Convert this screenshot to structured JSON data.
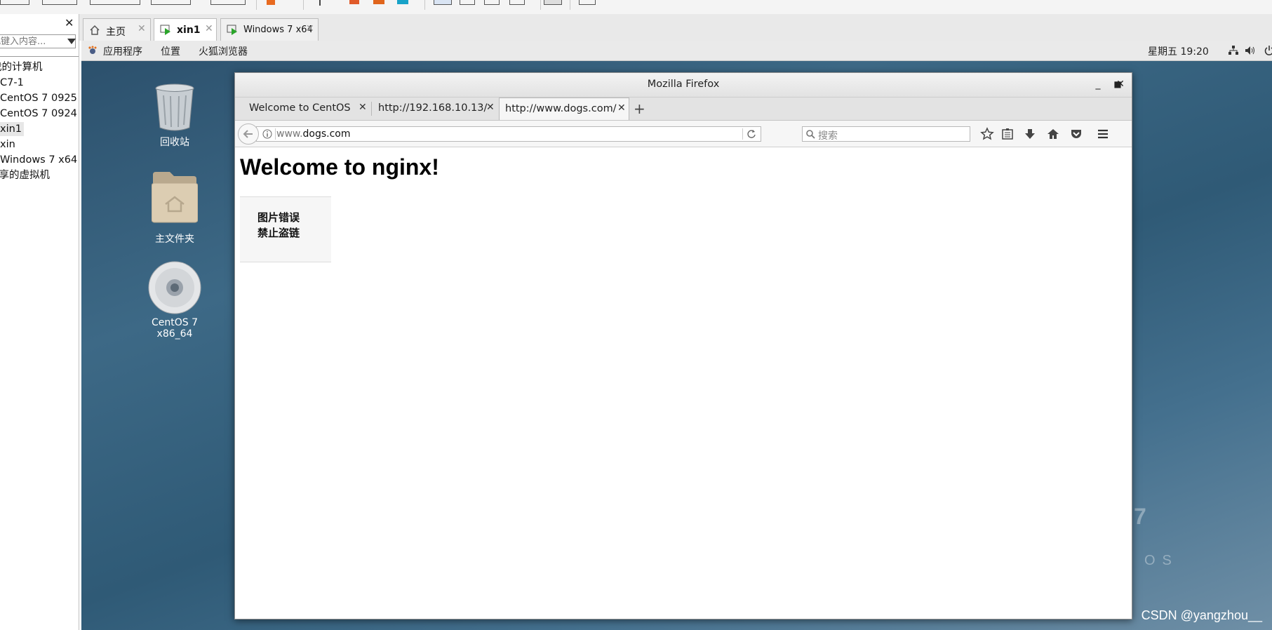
{
  "sidebar": {
    "search_placeholder": "在此键入内容...",
    "items": [
      "我的计算机",
      "C7-1",
      "CentOS 7 0925",
      "CentOS 7 0924",
      "xin1",
      "xin",
      "Windows 7 x64",
      "共享的虚拟机"
    ],
    "selected_index": 4
  },
  "vm_tabs": [
    {
      "label": "主页",
      "icon": "home-icon"
    },
    {
      "label": "xin1",
      "icon": "vm-running-icon",
      "active": true
    },
    {
      "label": "Windows 7 x64",
      "icon": "vm-running-icon"
    }
  ],
  "gnome": {
    "applications": "应用程序",
    "places": "位置",
    "firefox": "火狐浏览器",
    "clock": "星期五 19:20"
  },
  "desktop": {
    "icons": [
      {
        "label": "回收站",
        "icon": "trash-icon"
      },
      {
        "label": "主文件夹",
        "icon": "home-folder-icon"
      },
      {
        "label": "CentOS 7 x86_64",
        "icon": "disc-icon"
      }
    ]
  },
  "firefox": {
    "title": "Mozilla Firefox",
    "tabs": [
      {
        "label": "Welcome to CentOS"
      },
      {
        "label": "http://192.168.10.13/"
      },
      {
        "label": "http://www.dogs.com/",
        "active": true
      }
    ],
    "url_prefix": "www.",
    "url_domain": "dogs.com",
    "search_placeholder": "搜索",
    "page": {
      "heading": "Welcome to nginx!",
      "broken_image_line1": "图片错误",
      "broken_image_line2": "禁止盗链"
    }
  },
  "watermark": "CSDN @yangzhou__",
  "wallpaper_text": "OS",
  "wallpaper_digit": "7"
}
